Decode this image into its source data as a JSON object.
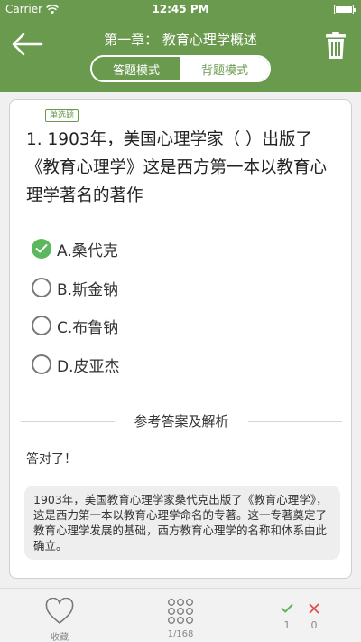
{
  "status_bar": {
    "carrier": "Carrier",
    "time": "12:45 PM"
  },
  "header": {
    "title": "第一章： 教育心理学概述",
    "modes": [
      "答题模式",
      "背题模式"
    ],
    "active_mode": "答题模式"
  },
  "question": {
    "type_badge": "单选题",
    "text": "1. 1903年，美国心理学家（  ）出版了《教育心理学》这是西方第一本以教育心理学著名的著作",
    "options": [
      {
        "label": "A.桑代克",
        "selected": true
      },
      {
        "label": "B.斯金钠",
        "selected": false
      },
      {
        "label": "C.布鲁钠",
        "selected": false
      },
      {
        "label": "D.皮亚杰",
        "selected": false
      }
    ]
  },
  "analysis": {
    "heading": "参考答案及解析",
    "result": "答对了！",
    "explanation": "1903年，美国教育心理学家桑代克出版了《教育心理学》，这是西力第一本以教育心理学命名的专著。这一专著奠定了教育心理学发展的基础，西方教育心理学的名称和体系由此确立。"
  },
  "bottom_bar": {
    "favorite_label": "收藏",
    "progress": "1/168",
    "correct_count": "1",
    "wrong_count": "0"
  },
  "colors": {
    "primary": "#6a9a4e",
    "correct": "#5cb85c",
    "wrong": "#e05050"
  }
}
